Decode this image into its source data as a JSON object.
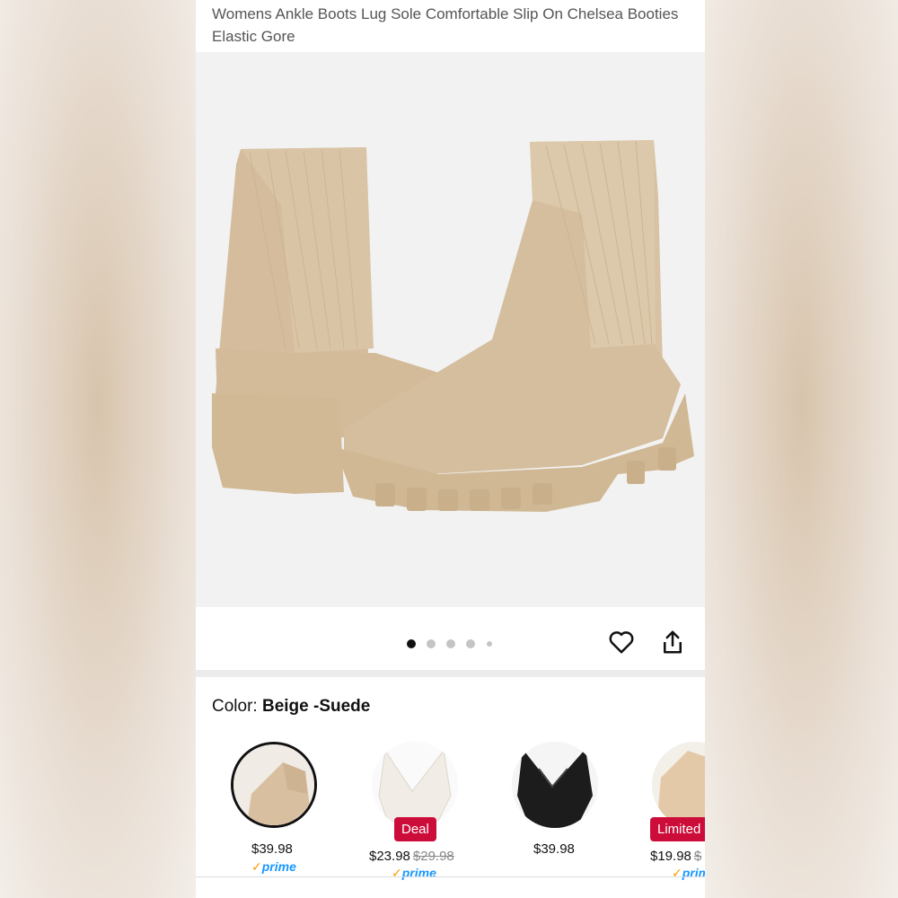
{
  "product": {
    "title": "Womens Ankle Boots Lug Sole Comfortable Slip On Chelsea Booties Elastic Gore"
  },
  "gallery": {
    "image_icon": "beige-suede-chelsea-boots-photo",
    "dots_count": 5,
    "active_dot": 1
  },
  "actions": {
    "favorite_icon": "heart-icon",
    "share_icon": "share-icon"
  },
  "color": {
    "label": "Color:",
    "selected_value": "Beige -Suede"
  },
  "variants": [
    {
      "color_hex": "#d8bf9f",
      "badge": "",
      "price": "$39.98",
      "was_price": "",
      "prime": "prime",
      "selected": true
    },
    {
      "color_hex": "#f1ede6",
      "badge": "Deal",
      "price": "$23.98",
      "was_price": "$29.98",
      "prime": "prime",
      "selected": false
    },
    {
      "color_hex": "#1c1c1c",
      "badge": "",
      "price": "$39.98",
      "was_price": "",
      "prime": "",
      "selected": false
    },
    {
      "color_hex": "#e4c9a8",
      "badge": "Limited",
      "price": "$19.98",
      "was_price": "$",
      "prime": "prime",
      "selected": false
    }
  ],
  "colors": {
    "badge_red": "#cc0c39",
    "prime_blue": "#1a98ff",
    "boot_tan": "#d6c0a2"
  }
}
